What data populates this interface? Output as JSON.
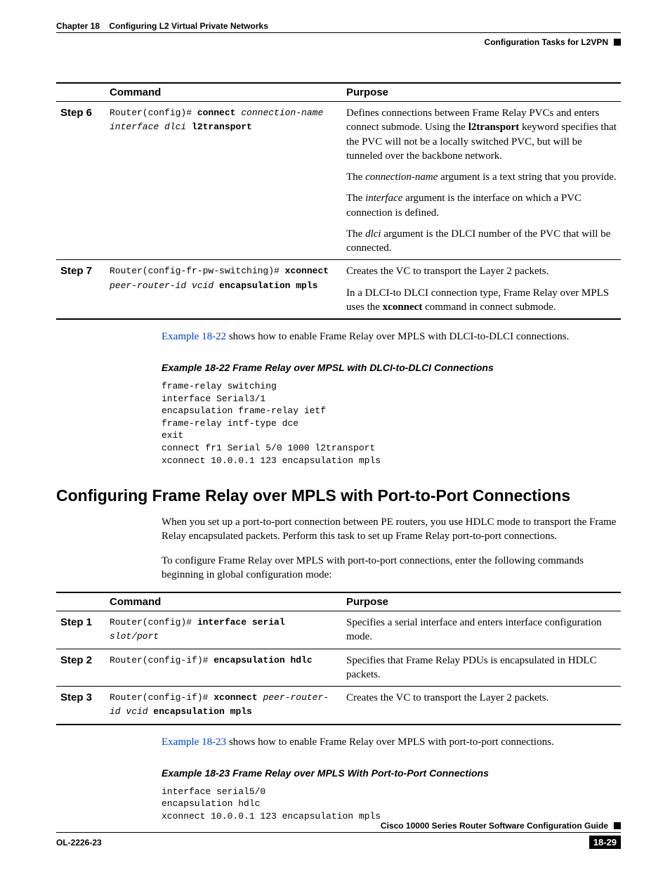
{
  "header": {
    "chapter_label": "Chapter 18",
    "chapter_title": "Configuring L2 Virtual Private Networks",
    "section_title": "Configuration Tasks for L2VPN"
  },
  "table1": {
    "col_command": "Command",
    "col_purpose": "Purpose",
    "rows": [
      {
        "step": "Step 6",
        "prompt": "Router(config)# ",
        "cmd_b1": "connect",
        "cmd_i1": " connection-name interface dlci ",
        "cmd_b2": "l2transport",
        "purpose": [
          {
            "pre": "Defines connections between Frame Relay PVCs and enters connect submode. Using the ",
            "b": "l2transport",
            "post": " keyword specifies that the PVC will not be a locally switched PVC, but will be tunneled over the backbone network."
          },
          {
            "pre": "The ",
            "i": "connection-name",
            "post": " argument is a text string that you provide."
          },
          {
            "pre": "The ",
            "i": "interface",
            "post": " argument is the interface on which a PVC connection is defined."
          },
          {
            "pre": "The ",
            "i": "dlci",
            "post": " argument is the DLCI number of the PVC that will be connected."
          }
        ]
      },
      {
        "step": "Step 7",
        "prompt": "Router(config-fr-pw-switching)# ",
        "cmd_b1": "xconnect",
        "cmd_i1": " peer-router-id vcid ",
        "cmd_b2": "encapsulation mpls",
        "purpose": [
          {
            "pre": "Creates the VC to transport the Layer 2 packets.",
            "b": "",
            "post": ""
          },
          {
            "pre": "In a DLCI-to DLCI connection type, Frame Relay over MPLS uses the ",
            "b": "xconnect",
            "post": " command in connect submode."
          }
        ]
      }
    ]
  },
  "para1_link": "Example 18-22",
  "para1_rest": " shows how to enable Frame Relay over MPLS with DLCI-to-DLCI connections.",
  "example1_title": "Example 18-22 Frame Relay over MPSL with DLCI-to-DLCI Connections",
  "example1_code": "frame-relay switching\ninterface Serial3/1\nencapsulation frame-relay ietf\nframe-relay intf-type dce\nexit\nconnect fr1 Serial 5/0 1000 l2transport\nxconnect 10.0.0.1 123 encapsulation mpls",
  "h2": "Configuring Frame Relay over MPLS with Port-to-Port Connections",
  "para2": "When you set up a port-to-port connection between PE routers, you use HDLC mode to transport the Frame Relay encapsulated packets. Perform this task to set up Frame Relay port-to-port connections.",
  "para3": "To configure Frame Relay over MPLS with port-to-port connections, enter the following commands beginning in global configuration mode:",
  "table2": {
    "col_command": "Command",
    "col_purpose": "Purpose",
    "rows": [
      {
        "step": "Step 1",
        "prompt": "Router(config)# ",
        "cmd_b1": "interface serial",
        "cmd_i1": " slot/port",
        "cmd_b2": "",
        "purpose": "Specifies a serial interface and enters interface configuration mode."
      },
      {
        "step": "Step 2",
        "prompt": "Router(config-if)# ",
        "cmd_b1": "encapsulation hdlc",
        "cmd_i1": "",
        "cmd_b2": "",
        "purpose": "Specifies that Frame Relay PDUs is encapsulated in HDLC packets."
      },
      {
        "step": "Step 3",
        "prompt": "Router(config-if)# ",
        "cmd_b1": "xconnect",
        "cmd_i1": " peer-router-id vcid ",
        "cmd_b2": "encapsulation mpls",
        "purpose": "Creates the VC to transport the Layer 2 packets."
      }
    ]
  },
  "para4_link": "Example 18-23",
  "para4_rest": " shows how to enable Frame Relay over MPLS with port-to-port connections.",
  "example2_title": "Example 18-23 Frame Relay over MPLS With Port-to-Port Connections",
  "example2_code": "interface serial5/0\nencapsulation hdlc\nxconnect 10.0.0.1 123 encapsulation mpls",
  "footer": {
    "guide": "Cisco 10000 Series Router Software Configuration Guide",
    "ol": "OL-2226-23",
    "page": "18-29"
  }
}
